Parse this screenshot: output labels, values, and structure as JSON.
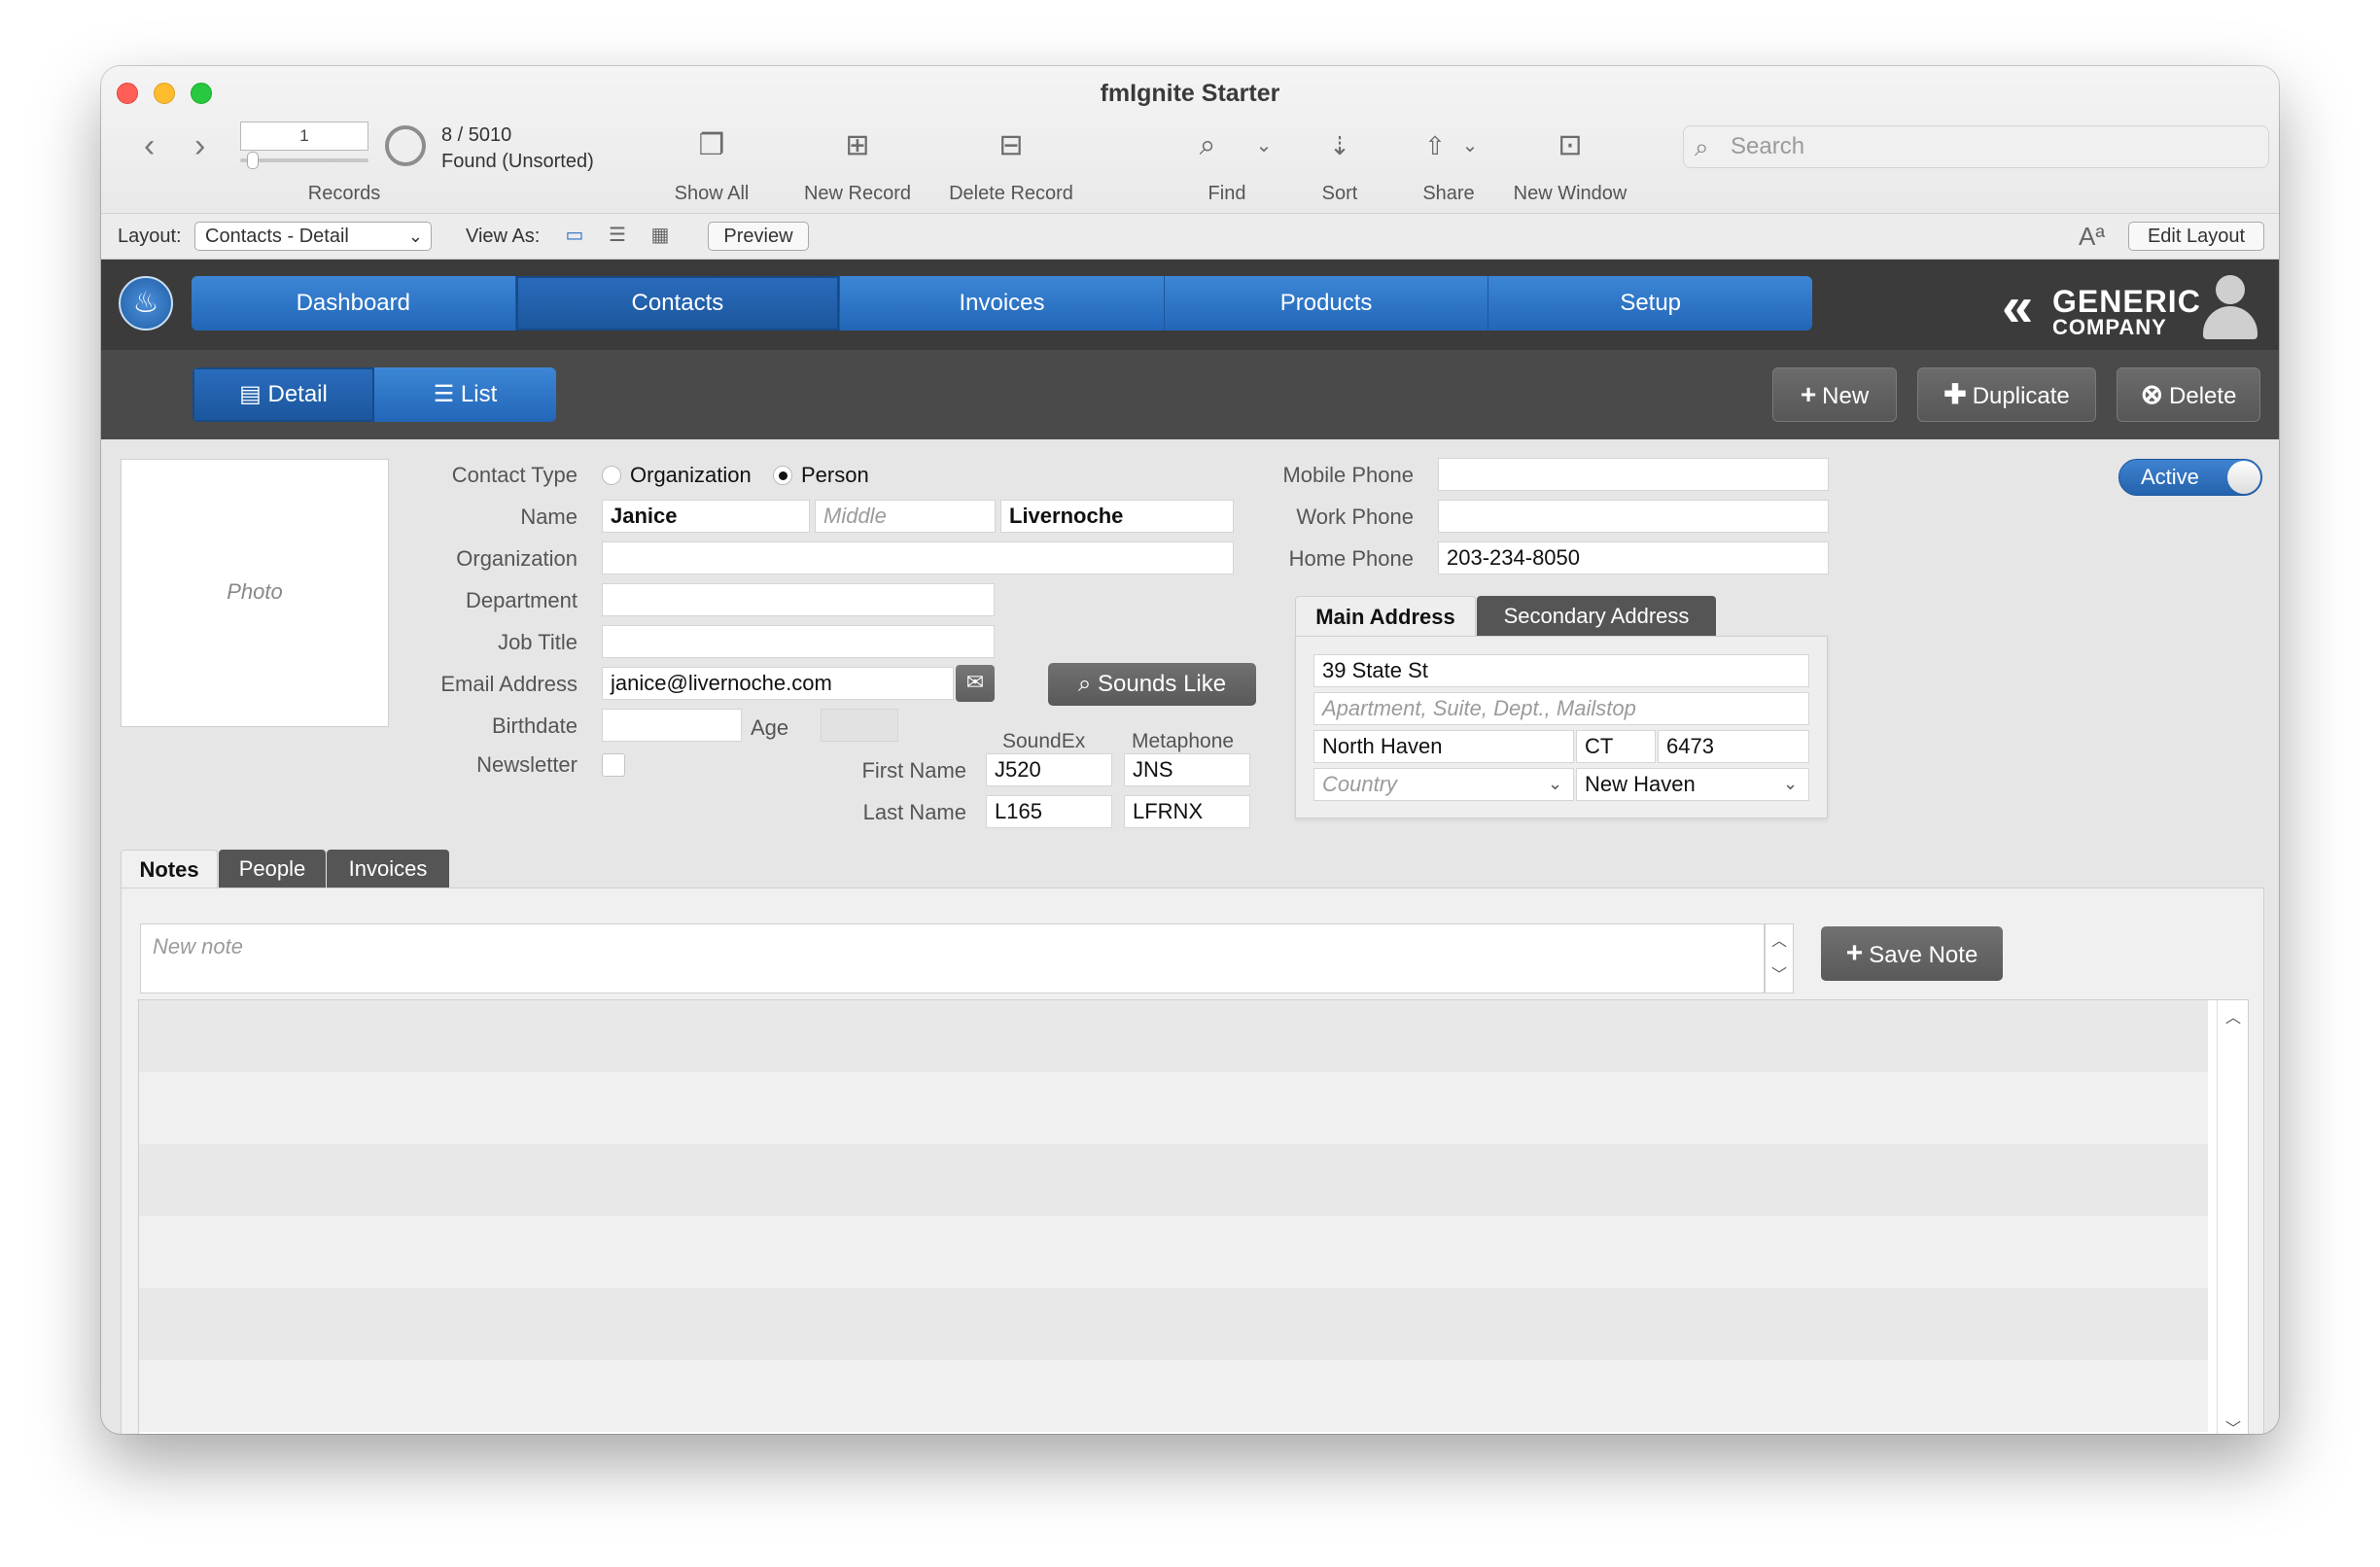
{
  "window": {
    "title": "fmIgnite Starter"
  },
  "toolbar": {
    "record_number": "1",
    "record_count": "8 / 5010",
    "found_status": "Found (Unsorted)",
    "records_label": "Records",
    "show_all_label": "Show All",
    "new_record_label": "New Record",
    "delete_record_label": "Delete Record",
    "find_label": "Find",
    "sort_label": "Sort",
    "share_label": "Share",
    "new_window_label": "New Window",
    "search_placeholder": "Search"
  },
  "layoutbar": {
    "layout_label": "Layout:",
    "layout_value": "Contacts - Detail",
    "view_as_label": "View As:",
    "preview_label": "Preview",
    "font_size_glyph": "Aª",
    "edit_layout_label": "Edit Layout"
  },
  "nav": {
    "tabs": [
      "Dashboard",
      "Contacts",
      "Invoices",
      "Products",
      "Setup"
    ],
    "active_tab": "Contacts",
    "brand_line1": "GENERIC",
    "brand_line2": "COMPANY"
  },
  "subnav": {
    "detail_label": "Detail",
    "list_label": "List",
    "new_label": "New",
    "duplicate_label": "Duplicate",
    "delete_label": "Delete"
  },
  "form": {
    "photo_placeholder": "Photo",
    "contact_type_label": "Contact Type",
    "contact_type_options": [
      "Organization",
      "Person"
    ],
    "contact_type_selected": "Person",
    "name_label": "Name",
    "first_name": "Janice",
    "middle_placeholder": "Middle",
    "last_name": "Livernoche",
    "organization_label": "Organization",
    "organization": "",
    "department_label": "Department",
    "department": "",
    "job_title_label": "Job Title",
    "job_title": "",
    "email_label": "Email Address",
    "email": "janice@livernoche.com",
    "birthdate_label": "Birthdate",
    "birthdate": "",
    "age_label": "Age",
    "age": "",
    "newsletter_label": "Newsletter",
    "newsletter_checked": false,
    "sounds_like_label": "Sounds Like",
    "soundex_header": "SoundEx",
    "metaphone_header": "Metaphone",
    "first_name_label": "First Name",
    "last_name_label": "Last Name",
    "soundex_first": "J520",
    "metaphone_first": "JNS",
    "soundex_last": "L165",
    "metaphone_last": "LFRNX",
    "mobile_phone_label": "Mobile Phone",
    "mobile_phone": "",
    "work_phone_label": "Work Phone",
    "work_phone": "",
    "home_phone_label": "Home Phone",
    "home_phone": "203-234-8050",
    "active_label": "Active"
  },
  "address": {
    "tabs": [
      "Main Address",
      "Secondary Address"
    ],
    "active_tab": "Main Address",
    "street": "39 State St",
    "street2_placeholder": "Apartment, Suite, Dept., Mailstop",
    "city": "North Haven",
    "state": "CT",
    "zip": "6473",
    "country_placeholder": "Country",
    "county": "New Haven"
  },
  "notes": {
    "tabs": [
      "Notes",
      "People",
      "Invoices"
    ],
    "active_tab": "Notes",
    "new_note_placeholder": "New note",
    "save_note_label": "Save Note"
  },
  "colors": {
    "nav_blue": "#2266b8",
    "dark_band": "#3b3b3b",
    "toolbar_bg": "#e9e9e9"
  }
}
